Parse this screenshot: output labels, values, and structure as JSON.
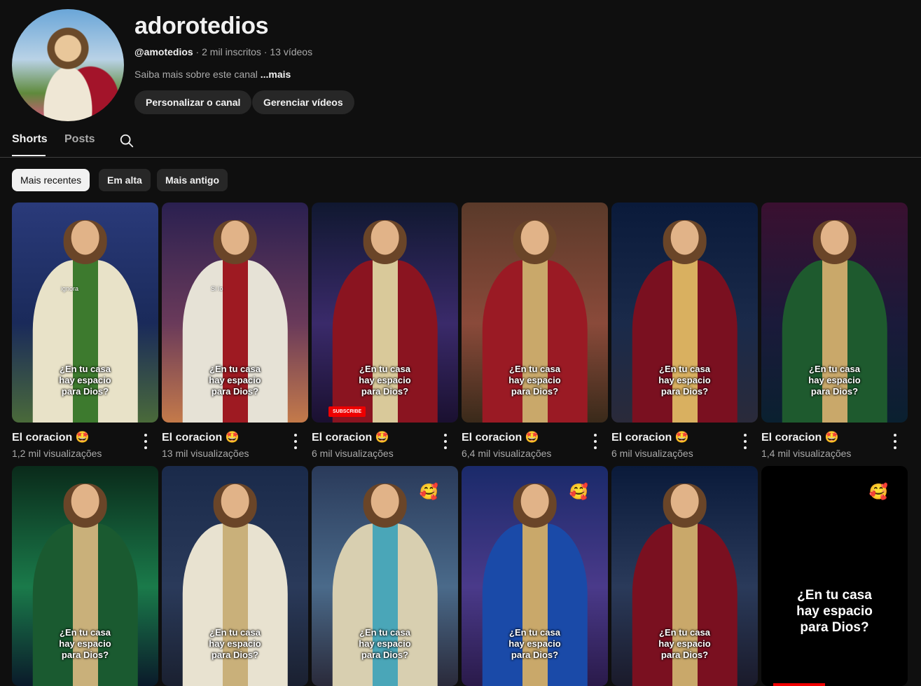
{
  "channel": {
    "name": "adorotedios",
    "handle": "@amotedios",
    "subscribers": "2 mil inscritos",
    "videos": "13 vídeos",
    "separator": " · ",
    "about": "Saiba mais sobre este canal",
    "about_more": "...mais",
    "buttons": {
      "customize": "Personalizar o canal",
      "manage": "Gerenciar vídeos"
    }
  },
  "tabs": [
    {
      "label": "Shorts",
      "active": true
    },
    {
      "label": "Posts",
      "active": false
    }
  ],
  "filters": [
    {
      "label": "Mais recentes",
      "active": true
    },
    {
      "label": "Em alta",
      "active": false
    },
    {
      "label": "Mais antigo",
      "active": false
    }
  ],
  "overlay_text": "¿En tu casa hay espacio para Dios?",
  "shorts_row1": [
    {
      "title": "El coracion 🤩",
      "views": "1,2 mil visualizações",
      "label": "ignora",
      "robe": "#e8e2c8",
      "sash": "#3d7a2e",
      "bg": [
        "#2a3a7a",
        "#1a2a5a",
        "#4a6a3a"
      ]
    },
    {
      "title": "El coracion 🤩",
      "views": "13 mil visualizações",
      "label": "Si lo",
      "robe": "#e6e2d6",
      "sash": "#9e1a22",
      "bg": [
        "#2a2050",
        "#6a3a5a",
        "#c47a4a"
      ]
    },
    {
      "title": "El coracion 🤩",
      "views": "6 mil visualizações",
      "label": "",
      "badge": "SUBSCRIBE",
      "robe": "#8a1420",
      "sash": "#d9c99a",
      "bg": [
        "#101830",
        "#3a2a6a",
        "#1a1030"
      ]
    },
    {
      "title": "El coracion 🤩",
      "views": "6,4 mil visualizações",
      "label": "",
      "robe": "#9a1a24",
      "sash": "#c9a86a",
      "bg": [
        "#5a3a2a",
        "#8a4a3a",
        "#3a2a1a"
      ]
    },
    {
      "title": "El coracion 🤩",
      "views": "6 mil visualizações",
      "label": "",
      "robe": "#7a1020",
      "sash": "#d9b060",
      "bg": [
        "#0a1a3a",
        "#1a2a4a",
        "#2a2a3a"
      ]
    },
    {
      "title": "El coracion 🤩",
      "views": "1,4 mil visualizações",
      "label": "",
      "robe": "#1e5a2e",
      "sash": "#c9a86a",
      "bg": [
        "#3a1030",
        "#1a1a3a",
        "#0a2030"
      ]
    }
  ],
  "shorts_row2": [
    {
      "robe": "#1a5a30",
      "sash": "#c9b07a",
      "bg": [
        "#0a2a1a",
        "#1a7a4a",
        "#0a1a2a"
      ]
    },
    {
      "robe": "#e8e2d0",
      "sash": "#c9b07a",
      "bg": [
        "#1a2a4a",
        "#2a3a5a",
        "#1a2030"
      ]
    },
    {
      "robe": "#d8cfb0",
      "sash": "#4aa6b8",
      "bg": [
        "#2a3a5a",
        "#4a6a8a",
        "#2a2a3a"
      ],
      "emoji": "🥰"
    },
    {
      "robe": "#1a4aa8",
      "sash": "#c9a86a",
      "bg": [
        "#1a2a6a",
        "#4a3a8a",
        "#2a1a4a"
      ],
      "emoji": "🥰"
    },
    {
      "robe": "#7a1020",
      "sash": "#c9a86a",
      "bg": [
        "#0a1a3a",
        "#2a3a5a",
        "#1a1a2a"
      ]
    },
    {
      "robe": "#000000",
      "sash": "#000000",
      "bg": [
        "#000000",
        "#000000",
        "#000000"
      ],
      "emoji": "🥰",
      "text_only": true
    }
  ],
  "colors": {
    "background": "#0f0f0f",
    "chip": "#272727",
    "text_secondary": "#aaaaaa",
    "accent_red": "#ee0000"
  }
}
